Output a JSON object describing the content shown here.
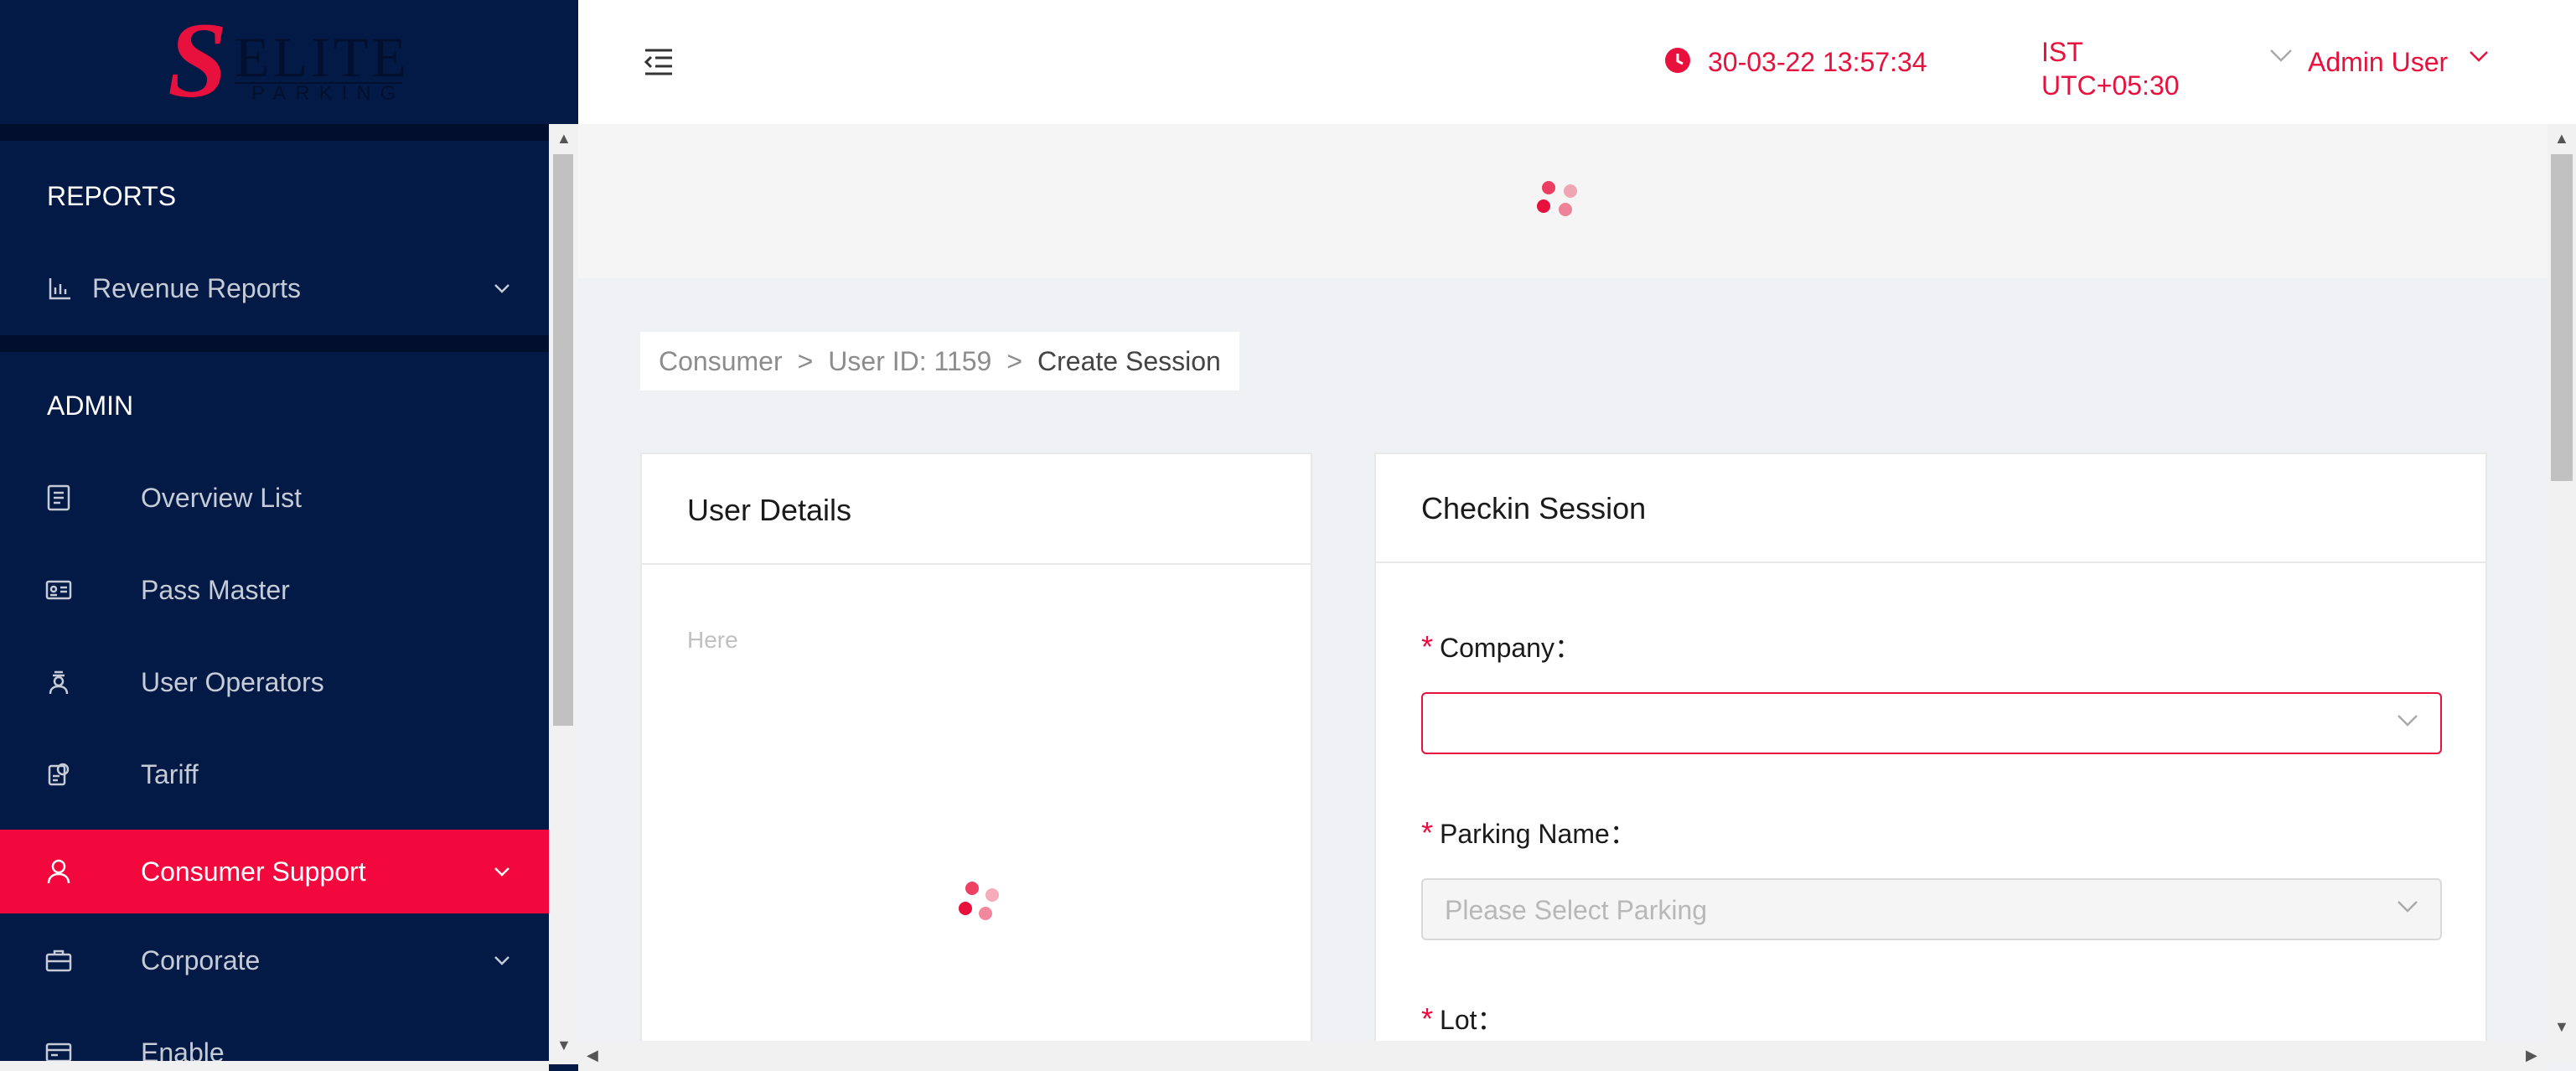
{
  "brand": {
    "logo_letter": "S",
    "logo_word": "ELITE",
    "logo_sub": "PARKING",
    "accent_color": "#e8103c",
    "sidebar_color": "#021a45"
  },
  "sidebar": {
    "sections": {
      "reports": "REPORTS",
      "admin": "ADMIN"
    },
    "items": [
      {
        "label": "Revenue Reports",
        "icon": "bar-chart-icon",
        "expandable": true
      },
      {
        "label": "Overview List",
        "icon": "list-document-icon"
      },
      {
        "label": "Pass Master",
        "icon": "id-card-icon"
      },
      {
        "label": "User Operators",
        "icon": "operator-icon"
      },
      {
        "label": "Tariff",
        "icon": "tariff-icon"
      },
      {
        "label": "Consumer Support",
        "icon": "user-icon",
        "expandable": true,
        "active": true
      },
      {
        "label": "Corporate",
        "icon": "briefcase-icon",
        "expandable": true
      },
      {
        "label": "Enable",
        "icon": "enable-icon"
      }
    ]
  },
  "header": {
    "datetime": "30-03-22 13:57:34",
    "timezone_abbr": "IST",
    "timezone_offset": "UTC+05:30",
    "user_name": "Admin User"
  },
  "breadcrumb": {
    "items": [
      "Consumer",
      "User ID: 1159"
    ],
    "current": "Create Session",
    "separator": ">"
  },
  "user_details": {
    "title": "User Details",
    "body_text": "Here"
  },
  "checkin": {
    "title": "Checkin Session",
    "fields": [
      {
        "label": "Company",
        "required": true,
        "placeholder": "",
        "state": "focused"
      },
      {
        "label": "Parking Name",
        "required": true,
        "placeholder": "Please Select Parking",
        "state": "disabled"
      },
      {
        "label": "Lot",
        "required": true
      }
    ],
    "label_colon": "："
  }
}
